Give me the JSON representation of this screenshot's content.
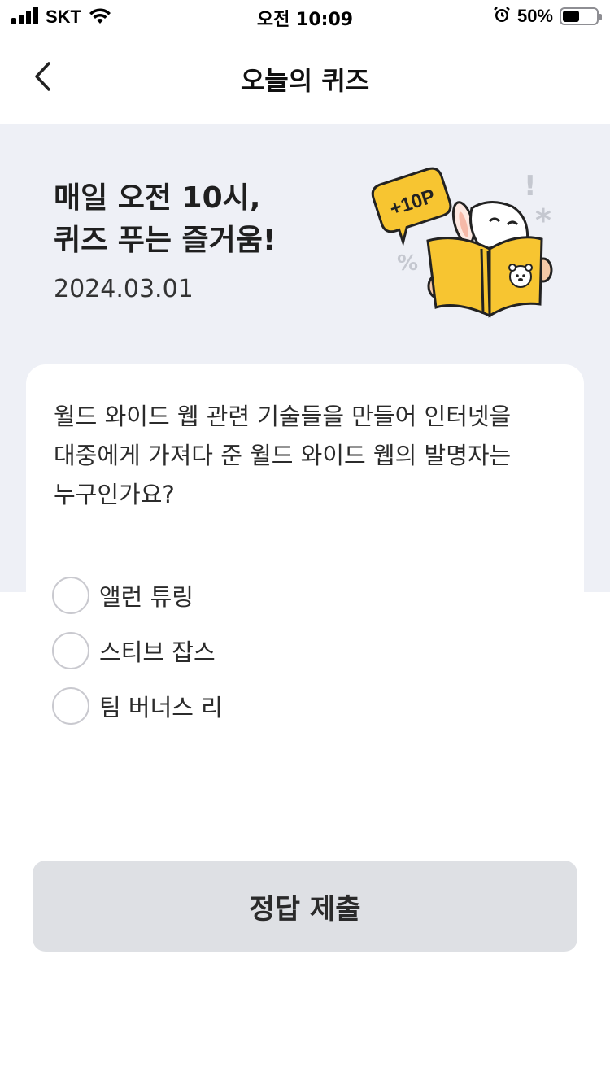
{
  "status_bar": {
    "carrier": "SKT",
    "time": "오전 10:09",
    "battery_percent": "50%",
    "battery_level": 0.5,
    "icons": [
      "signal-icon",
      "wifi-icon",
      "alarm-icon",
      "battery-icon"
    ]
  },
  "nav": {
    "title": "오늘의 퀴즈",
    "back_icon": "chevron-left-icon"
  },
  "hero": {
    "title_line1": "매일 오전 10시,",
    "title_line2": "퀴즈 푸는 즐거움!",
    "date": "2024.03.01",
    "illustration_badge": "+10P",
    "illustration_symbols": [
      "!",
      "*",
      "%"
    ]
  },
  "quiz": {
    "question": "월드 와이드 웹 관련 기술들을 만들어 인터넷을 대중에게 가져다 준 월드 와이드 웹의 발명자는 누구인가요?",
    "options": [
      {
        "label": "앨런 튜링",
        "selected": false
      },
      {
        "label": "스티브 잡스",
        "selected": false
      },
      {
        "label": "팀 버너스 리",
        "selected": false
      }
    ]
  },
  "submit": {
    "label": "정답 제출"
  },
  "colors": {
    "hero_bg": "#eef0f6",
    "badge_yellow": "#f7c531",
    "button_bg": "#dee0e4"
  }
}
